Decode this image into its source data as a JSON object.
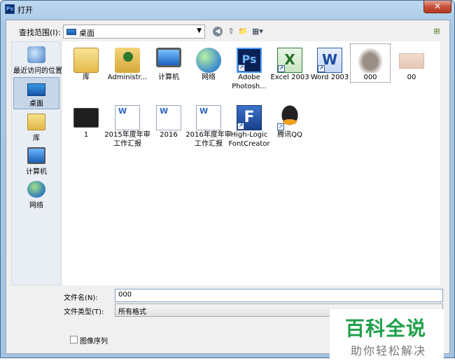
{
  "titlebar": {
    "icon_text": "Ps",
    "title": "打开",
    "close_label": "✕"
  },
  "toolbar": {
    "lookin_label": "查找范围(I):",
    "lookin_value": "桌面",
    "back_glyph": "◀",
    "up_glyph": "⇧",
    "newfolder_glyph": "📁",
    "view_glyph": "▦▾",
    "right_glyph": "⊞"
  },
  "places": [
    {
      "label": "最近访问的位置",
      "icon": "recent-places-icon"
    },
    {
      "label": "桌面",
      "icon": "desktop-icon"
    },
    {
      "label": "库",
      "icon": "library-icon"
    },
    {
      "label": "计算机",
      "icon": "computer-icon"
    },
    {
      "label": "网络",
      "icon": "network-icon"
    }
  ],
  "files": [
    {
      "name": "库",
      "icon": "library-icon"
    },
    {
      "name": "Administr...",
      "icon": "user-folder-icon"
    },
    {
      "name": "计算机",
      "icon": "computer-icon"
    },
    {
      "name": "网络",
      "icon": "network-icon"
    },
    {
      "name": "Adobe Photosh...",
      "icon": "photoshop-icon",
      "glyph": "Ps"
    },
    {
      "name": "Excel 2003",
      "icon": "excel-icon",
      "glyph": "X"
    },
    {
      "name": "Word 2003",
      "icon": "word-icon",
      "glyph": "W"
    },
    {
      "name": "000",
      "icon": "elephant-image-icon"
    },
    {
      "name": "00",
      "icon": "photo-image-icon"
    },
    {
      "name": "1",
      "icon": "black-image-icon"
    },
    {
      "name": "2015年度年审工作汇报",
      "icon": "wps-document-icon",
      "glyph": "W"
    },
    {
      "name": "2016",
      "icon": "wps-document-icon",
      "glyph": "W"
    },
    {
      "name": "2016年度年审工作汇报",
      "icon": "wps-document-icon",
      "glyph": "W"
    },
    {
      "name": "High-Logic FontCreator",
      "icon": "fontcreator-icon",
      "glyph": "F"
    },
    {
      "name": "腾讯QQ",
      "icon": "qq-icon"
    }
  ],
  "bottom": {
    "filename_label": "文件名(N):",
    "filename_value": "000",
    "filetype_label": "文件类型(T):",
    "filetype_value": "所有格式",
    "sequence_label": "图像序列"
  },
  "watermark": {
    "main": "百科全说",
    "sub": "助你轻松解决"
  },
  "colors": {
    "title_gradient": "#bcd7ee",
    "selection": "#c6d6e8",
    "watermark_green": "#1ea04a"
  }
}
